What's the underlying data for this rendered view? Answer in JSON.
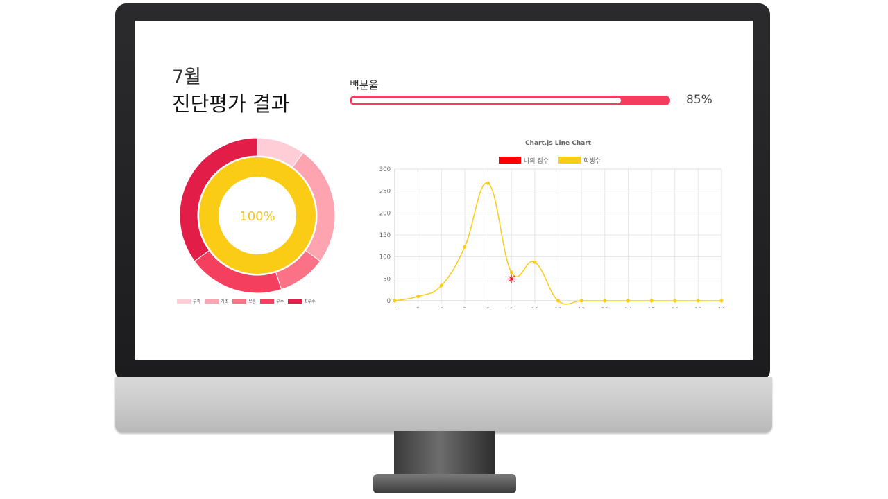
{
  "header": {
    "month": "7월",
    "title": "진단평가 결과"
  },
  "progress": {
    "label": "백분율",
    "value": 85,
    "value_text": "85%",
    "color": "#f23d5f"
  },
  "donut": {
    "center_text": "100%",
    "center_color": "#f5c518",
    "outer_segments": [
      {
        "label": "부족",
        "value": 10,
        "color": "#fecdd5"
      },
      {
        "label": "기초",
        "value": 25,
        "color": "#fda4b0"
      },
      {
        "label": "보통",
        "value": 10,
        "color": "#fb7185"
      },
      {
        "label": "우수",
        "value": 20,
        "color": "#f43f5e"
      },
      {
        "label": "최우수",
        "value": 35,
        "color": "#e11d48"
      }
    ],
    "inner_color": "#facc15"
  },
  "chart_data": {
    "type": "line",
    "title": "Chart.js Line Chart",
    "xlabel": "학생수",
    "ylabel": "",
    "x": [
      4,
      5,
      6,
      7,
      8,
      9,
      10,
      11,
      12,
      13,
      14,
      15,
      16,
      17,
      18
    ],
    "ylim": [
      0,
      300
    ],
    "yticks": [
      0,
      50,
      100,
      150,
      200,
      250,
      300
    ],
    "grid": true,
    "legend_position": "top",
    "series": [
      {
        "name": "나의 점수",
        "color": "#ff0000",
        "points": [
          {
            "x": 9,
            "y": 50
          }
        ]
      },
      {
        "name": "학생수",
        "color": "#facc15",
        "values": [
          0,
          10,
          35,
          123,
          268,
          65,
          88,
          0,
          0,
          0,
          0,
          0,
          0,
          0,
          0
        ]
      }
    ]
  }
}
